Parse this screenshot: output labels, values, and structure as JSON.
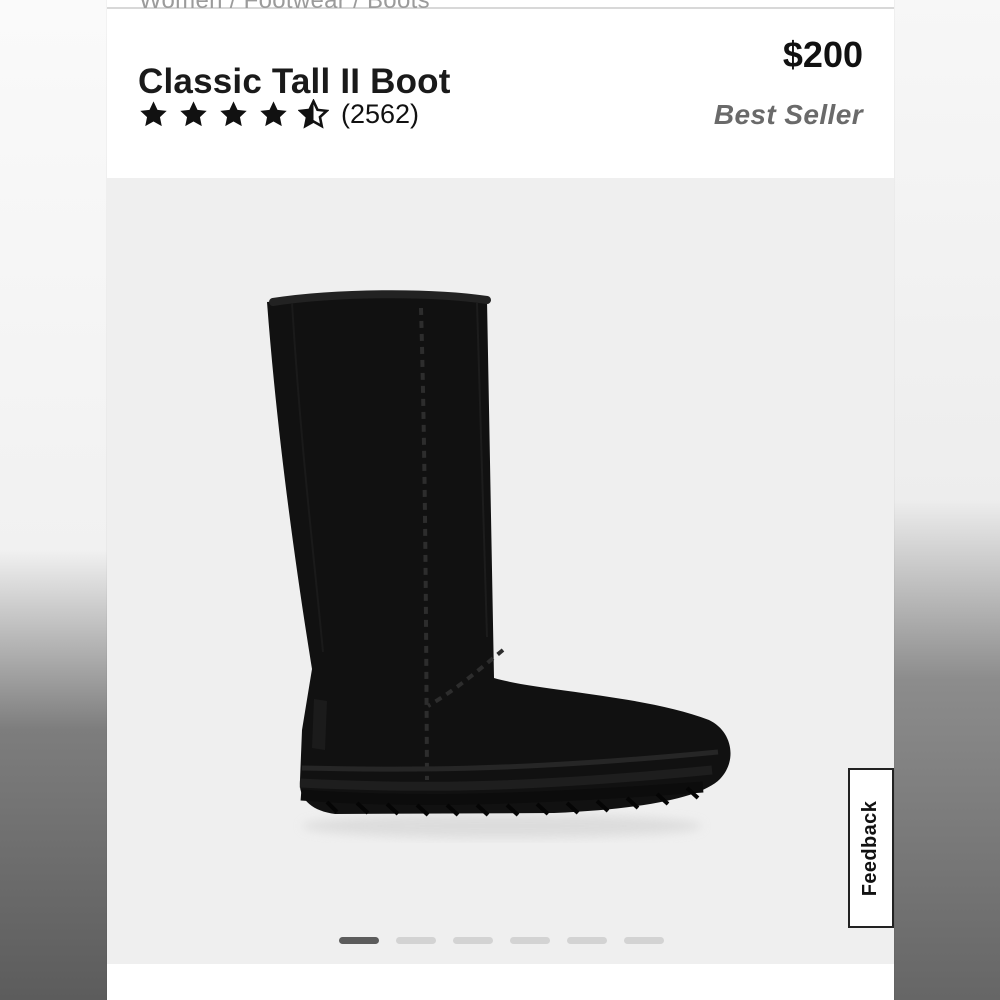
{
  "product": {
    "breadcrumb": "Women / Footwear / Boots",
    "title": "Classic Tall II Boot",
    "price": "$200",
    "rating_count": "(2562)",
    "badge": "Best Seller",
    "rating_value": 4.5,
    "rating_max": 5
  },
  "carousel": {
    "slides": 6,
    "active_index": 0
  },
  "feedback": {
    "label": "Feedback"
  },
  "colors": {
    "text": "#111111",
    "muted_text": "#6a6a6a",
    "stage_background": "#efefef",
    "active_dot": "#5c5c5c",
    "inactive_dot": "#d3d3d3",
    "boot": "#111111"
  },
  "icons": {
    "rating": "star-icon",
    "half_rating": "star-half-icon"
  }
}
